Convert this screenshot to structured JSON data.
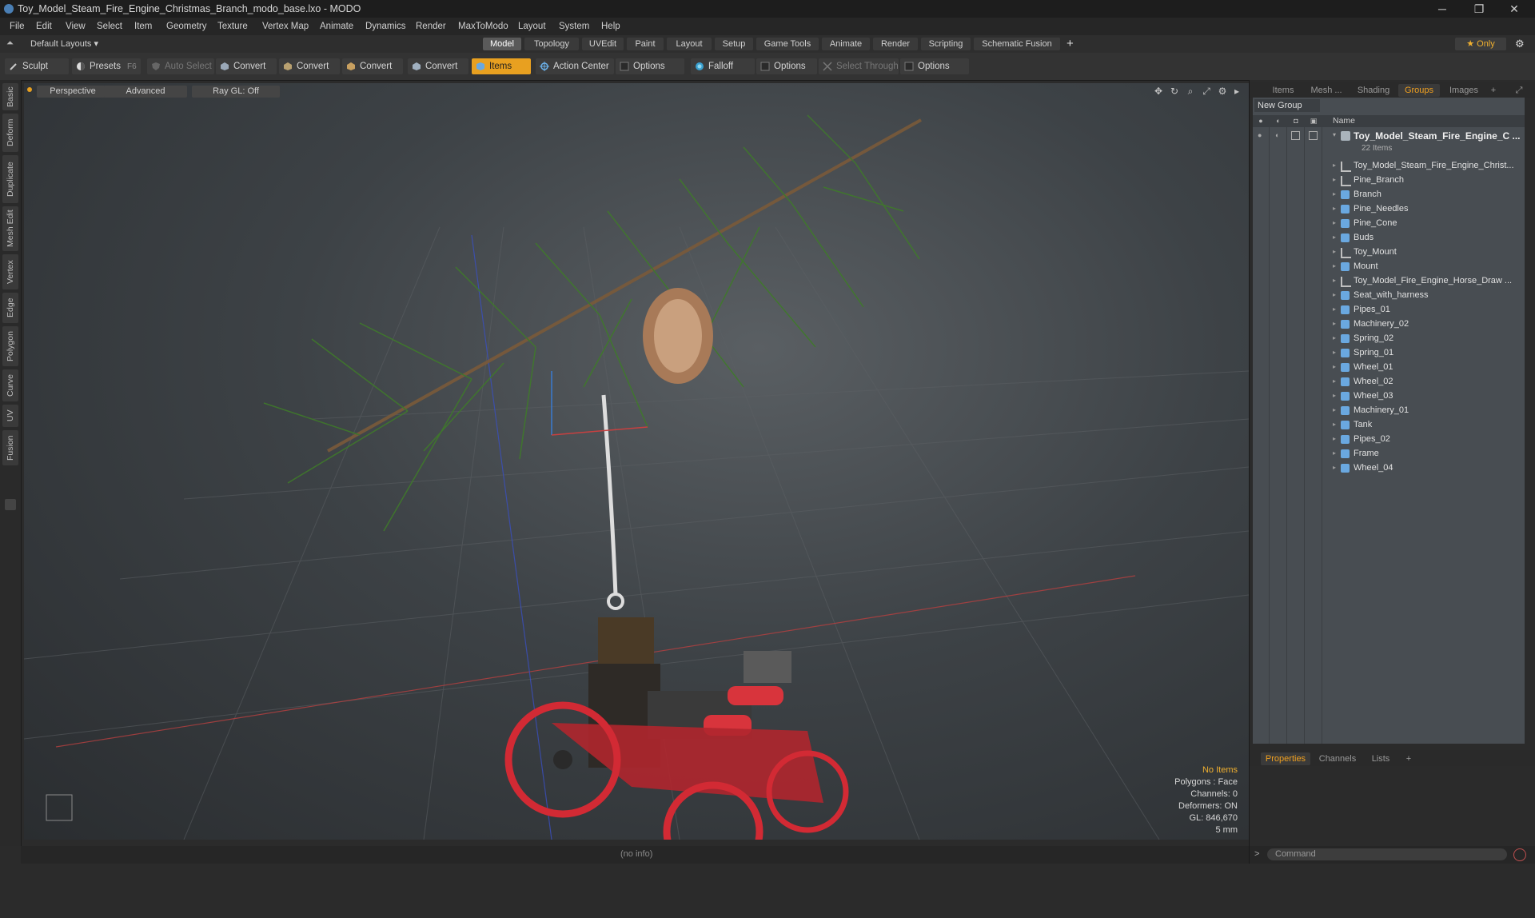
{
  "window": {
    "title": "Toy_Model_Steam_Fire_Engine_Christmas_Branch_modo_base.lxo - MODO",
    "minimize": "─",
    "restore": "❐",
    "close": "✕"
  },
  "menu": [
    "File",
    "Edit",
    "View",
    "Select",
    "Item",
    "Geometry",
    "Texture",
    "Vertex Map",
    "Animate",
    "Dynamics",
    "Render",
    "MaxToModo",
    "Layout",
    "System",
    "Help"
  ],
  "layoutbar": {
    "layouts_label": "Default Layouts ▾",
    "tabs": [
      "Model",
      "Topology",
      "UVEdit",
      "Paint",
      "Layout",
      "Setup",
      "Game Tools",
      "Animate",
      "Render",
      "Scripting",
      "Schematic Fusion"
    ],
    "active_tab": "Model",
    "add": "+",
    "only_label": "★  Only"
  },
  "toolbar": {
    "sculpt": "Sculpt",
    "presets": "Presets",
    "presets_shortcut": "F6",
    "auto_select": "Auto Select",
    "convert": "Convert",
    "items": "Items",
    "action_center": "Action Center",
    "options": "Options",
    "falloff": "Falloff",
    "select_through": "Select Through"
  },
  "lefttabs": [
    "Basic",
    "Deform",
    "Duplicate",
    "Mesh Edit",
    "Vertex",
    "Edge",
    "Polygon",
    "Curve",
    "UV",
    "Fusion"
  ],
  "viewport": {
    "view_mode": "Perspective",
    "shading": "Advanced",
    "raygl": "Ray GL: Off",
    "info": {
      "selection": "No Items",
      "polygons": "Polygons : Face",
      "channels": "Channels: 0",
      "deformers": "Deformers: ON",
      "gl": "GL: 846,670",
      "grid": "5 mm"
    }
  },
  "statusbar": {
    "info": "(no info)"
  },
  "rightpanel": {
    "tabs": [
      "Items",
      "Mesh ...",
      "Shading",
      "Groups",
      "Images"
    ],
    "active_tab": "Groups",
    "new_group": "New Group",
    "column_name": "Name",
    "root": "Toy_Model_Steam_Fire_Engine_C ...",
    "root_count": "22 Items",
    "items": [
      {
        "label": "Toy_Model_Steam_Fire_Engine_Christ...",
        "type": "locator"
      },
      {
        "label": "Pine_Branch",
        "type": "locator"
      },
      {
        "label": "Branch",
        "type": "mesh"
      },
      {
        "label": "Pine_Needles",
        "type": "mesh"
      },
      {
        "label": "Pine_Cone",
        "type": "mesh"
      },
      {
        "label": "Buds",
        "type": "mesh"
      },
      {
        "label": "Toy_Mount",
        "type": "locator"
      },
      {
        "label": "Mount",
        "type": "mesh"
      },
      {
        "label": "Toy_Model_Fire_Engine_Horse_Draw ...",
        "type": "locator"
      },
      {
        "label": "Seat_with_harness",
        "type": "mesh"
      },
      {
        "label": "Pipes_01",
        "type": "mesh"
      },
      {
        "label": "Machinery_02",
        "type": "mesh"
      },
      {
        "label": "Spring_02",
        "type": "mesh"
      },
      {
        "label": "Spring_01",
        "type": "mesh"
      },
      {
        "label": "Wheel_01",
        "type": "mesh"
      },
      {
        "label": "Wheel_02",
        "type": "mesh"
      },
      {
        "label": "Wheel_03",
        "type": "mesh"
      },
      {
        "label": "Machinery_01",
        "type": "mesh"
      },
      {
        "label": "Tank",
        "type": "mesh"
      },
      {
        "label": "Pipes_02",
        "type": "mesh"
      },
      {
        "label": "Frame",
        "type": "mesh"
      },
      {
        "label": "Wheel_04",
        "type": "mesh"
      }
    ],
    "prop_tabs": [
      "Properties",
      "Channels",
      "Lists"
    ],
    "active_prop_tab": "Properties",
    "command_placeholder": "Command",
    "command_prompt": ">"
  },
  "colors": {
    "accent": "#f0a020",
    "mesh_icon": "#6aa8e0",
    "viewport_bg": "#3d4246"
  }
}
